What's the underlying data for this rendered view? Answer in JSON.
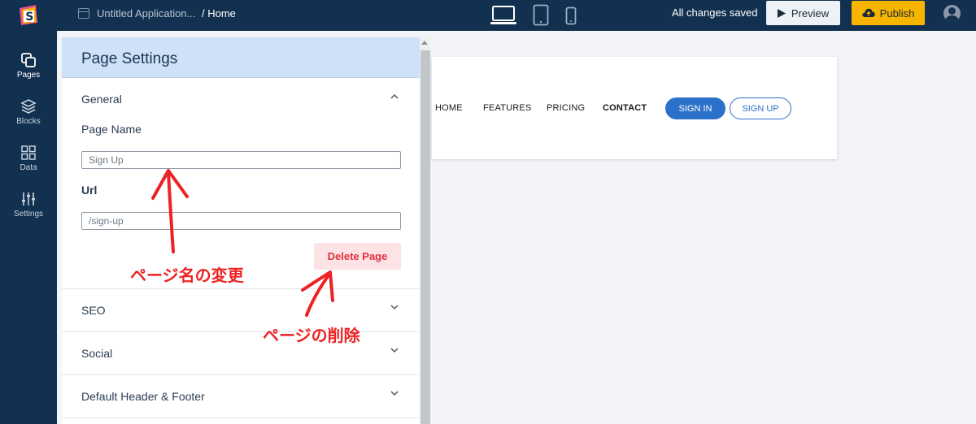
{
  "topbar": {
    "app_title": "Untitled Application...",
    "breadcrumb": "/ Home",
    "status": "All changes saved",
    "preview_label": "Preview",
    "publish_label": "Publish",
    "colors": {
      "bar": "#12304f",
      "publish": "#f7b500"
    }
  },
  "rail": {
    "items": [
      {
        "label": "Pages",
        "icon": "pages-icon"
      },
      {
        "label": "Blocks",
        "icon": "blocks-icon"
      },
      {
        "label": "Data",
        "icon": "data-grid-icon"
      },
      {
        "label": "Settings",
        "icon": "sliders-icon"
      }
    ]
  },
  "panel": {
    "title": "Page Settings",
    "general": {
      "title": "General",
      "page_name_label": "Page Name",
      "page_name_value": "Sign Up",
      "url_label": "Url",
      "url_value": "/sign-up",
      "delete_label": "Delete Page"
    },
    "sections": [
      "SEO",
      "Social",
      "Default Header & Footer"
    ]
  },
  "preview": {
    "nav": [
      "HOME",
      "FEATURES",
      "PRICING",
      "CONTACT"
    ],
    "sign_in": "SIGN IN",
    "sign_up": "SIGN UP"
  },
  "annotations": {
    "rename": "ページ名の変更",
    "delete": "ページの削除",
    "color": "#ee2222"
  }
}
